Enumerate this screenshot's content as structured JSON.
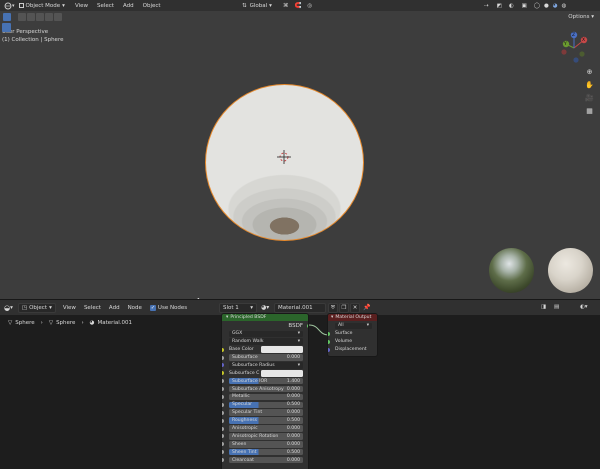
{
  "viewport": {
    "mode_label": "Object Mode",
    "menus": [
      "View",
      "Select",
      "Add",
      "Object"
    ],
    "orientation_label": "Global",
    "options_label": "Options",
    "view_name": "User Perspective",
    "collection_info": "(1) Collection | Sphere",
    "gizmo_axes": [
      "X",
      "Y",
      "Z"
    ]
  },
  "node_editor": {
    "type_label": "Object",
    "menus": [
      "View",
      "Select",
      "Add",
      "Node"
    ],
    "use_nodes_label": "Use Nodes",
    "slot_label": "Slot 1",
    "material_name": "Material.001",
    "breadcrumb": [
      "Sphere",
      "Sphere",
      "Material.001"
    ]
  },
  "bsdf_node": {
    "title": "Principled BSDF",
    "output_label": "BSDF",
    "distribution": "GGX",
    "subsurface_method": "Random Walk",
    "base_color_label": "Base Color",
    "subsurface_label": "Subsurface",
    "subsurface_value": "0.000",
    "subsurface_radius_label": "Subsurface Radius",
    "subsurface_color_label": "Subsurface C",
    "params": [
      {
        "label": "Subsurface IOR",
        "value": "1.400",
        "highlight": true
      },
      {
        "label": "Subsurface Anisotropy",
        "value": "0.000",
        "highlight": false
      },
      {
        "label": "Metallic",
        "value": "0.000",
        "highlight": false
      },
      {
        "label": "Specular",
        "value": "0.500",
        "highlight": true
      },
      {
        "label": "Specular Tint",
        "value": "0.000",
        "highlight": false
      },
      {
        "label": "Roughness",
        "value": "0.500",
        "highlight": true
      },
      {
        "label": "Anisotropic",
        "value": "0.000",
        "highlight": false
      },
      {
        "label": "Anisotropic Rotation",
        "value": "0.000",
        "highlight": false
      },
      {
        "label": "Sheen",
        "value": "0.000",
        "highlight": false
      },
      {
        "label": "Sheen Tint",
        "value": "0.500",
        "highlight": true
      },
      {
        "label": "Clearcoat",
        "value": "0.000",
        "highlight": false
      }
    ]
  },
  "output_node": {
    "title": "Material Output",
    "target": "All",
    "inputs": [
      "Surface",
      "Volume",
      "Displacement"
    ]
  },
  "colors": {
    "selection_orange": "#e6892c",
    "accent_blue": "#4772b3",
    "bsdf_header_green": "#2b652b",
    "output_header_red": "#5a1f1f"
  }
}
